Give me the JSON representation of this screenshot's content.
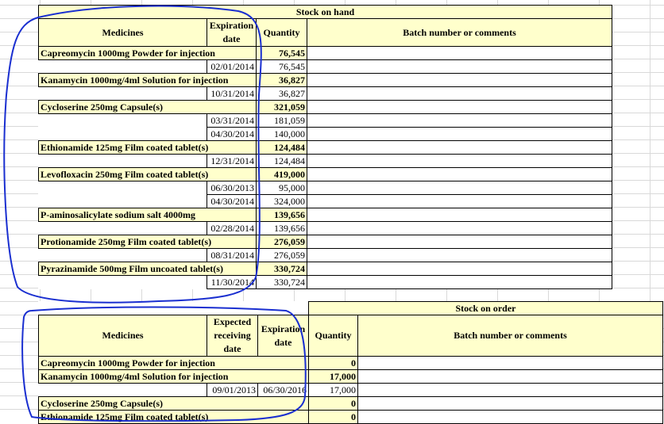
{
  "stock_on_hand": {
    "title": "Stock on hand",
    "headers": {
      "medicines": "Medicines",
      "expiration_date": "Expiration date",
      "quantity": "Quantity",
      "batch": "Batch number or comments"
    },
    "items": [
      {
        "name": "Capreomycin  1000mg  Powder for injection",
        "total": "76,545",
        "lots": [
          {
            "date": "02/01/2014",
            "qty": "76,545"
          }
        ]
      },
      {
        "name": "Kanamycin  1000mg/4ml  Solution for injection",
        "total": "36,827",
        "lots": [
          {
            "date": "10/31/2014",
            "qty": "36,827"
          }
        ]
      },
      {
        "name": "Cycloserine  250mg  Capsule(s)",
        "total": "321,059",
        "lots": [
          {
            "date": "03/31/2014",
            "qty": "181,059"
          },
          {
            "date": "04/30/2014",
            "qty": "140,000"
          }
        ]
      },
      {
        "name": "Ethionamide  125mg  Film coated tablet(s)",
        "total": "124,484",
        "lots": [
          {
            "date": "12/31/2014",
            "qty": "124,484"
          }
        ]
      },
      {
        "name": "Levofloxacin  250mg  Film coated tablet(s)",
        "total": "419,000",
        "lots": [
          {
            "date": "06/30/2013",
            "qty": "95,000"
          },
          {
            "date": "04/30/2014",
            "qty": "324,000"
          }
        ]
      },
      {
        "name": "P-aminosalicylate sodium salt  4000mg",
        "total": "139,656",
        "lots": [
          {
            "date": "02/28/2014",
            "qty": "139,656"
          }
        ]
      },
      {
        "name": "Protionamide   250mg  Film coated tablet(s)",
        "total": "276,059",
        "lots": [
          {
            "date": "08/31/2014",
            "qty": "276,059"
          }
        ]
      },
      {
        "name": "Pyrazinamide  500mg  Film uncoated tablet(s)",
        "total": "330,724",
        "lots": [
          {
            "date": "11/30/2014",
            "qty": "330,724"
          }
        ]
      }
    ]
  },
  "stock_on_order": {
    "title": "Stock on order",
    "headers": {
      "medicines": "Medicines",
      "expected_date": "Expected receiving date",
      "expiration_date": "Expiration date",
      "quantity": "Quantity",
      "batch": "Batch number or comments"
    },
    "items": [
      {
        "name": "Capreomycin  1000mg  Powder for injection",
        "total": "0",
        "lots": []
      },
      {
        "name": "Kanamycin  1000mg/4ml  Solution for injection",
        "total": "17,000",
        "lots": [
          {
            "expected": "09/01/2013",
            "expiration": "06/30/2016",
            "qty": "17,000"
          }
        ]
      },
      {
        "name": "Cycloserine  250mg  Capsule(s)",
        "total": "0",
        "lots": []
      },
      {
        "name": "Ethionamide  125mg  Film coated tablet(s)",
        "total": "0",
        "lots": []
      }
    ]
  },
  "colors": {
    "header_fill": "#ffffcc",
    "ink": "#1a2fd0",
    "gridline": "#d9d9d9"
  }
}
